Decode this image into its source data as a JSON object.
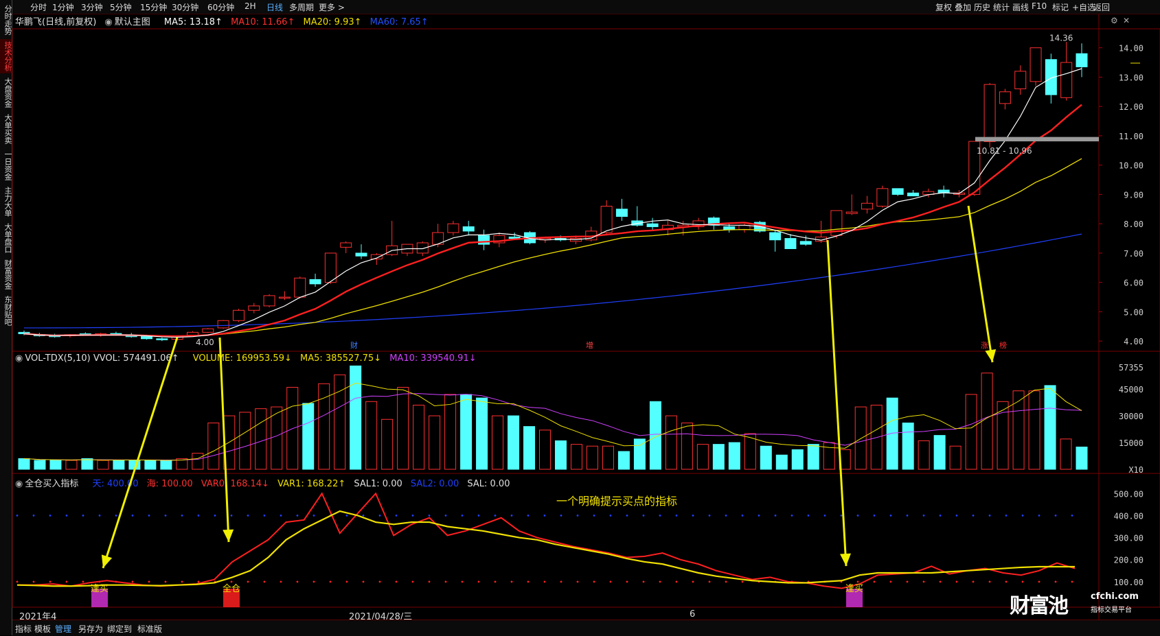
{
  "topbar": {
    "items": [
      "分时",
      "1分钟",
      "3分钟",
      "5分钟",
      "15分钟",
      "30分钟",
      "60分钟",
      "2H",
      "日线",
      "多周期",
      "更多 >"
    ],
    "right": [
      "复权",
      "叠加",
      "历史",
      "统计",
      "画线",
      "F10",
      "标记",
      "+自选",
      "返回"
    ]
  },
  "sidebar": {
    "items": [
      "分时走势",
      "技术分析",
      "大盘资金",
      "大单买卖",
      "一日资金",
      "主力大单",
      "大单盘口",
      "财富资金",
      "东财贴吧"
    ]
  },
  "price_panel": {
    "title": "华鹏飞(日线,前复权)",
    "template": "默认主图",
    "ma5": "MA5: 13.18↑",
    "ma10": "MA10: 11.66↑",
    "ma20": "MA20: 9.93↑",
    "ma60": "MA60: 7.65↑",
    "high_label": "14.36",
    "low_label": "4.00",
    "range_label": "10.81 - 10.96",
    "marker_cai": "财",
    "marker_zeng": "增",
    "marker_zhang": "涨",
    "marker_bang": "榜",
    "colors": {
      "ma5": "#ffffff",
      "ma10": "#ff2020",
      "ma20": "#f0e000",
      "ma60": "#2040ff",
      "up": "#ff3030",
      "down": "#54ffff"
    }
  },
  "volume_panel": {
    "title": "VOL-TDX(5,10) VVOL: 574491.06↑",
    "volume": "VOLUME: 169953.59↓",
    "ma5": "MA5: 385527.75↓",
    "ma10": "MA10: 339540.91↓",
    "unit": "X10",
    "axis_top": "57355"
  },
  "indicator_panel": {
    "title": "全仓买入指标",
    "tian": "天: 400.00",
    "hai": "海: 100.00",
    "var0": "VAR0: 168.14↓",
    "var1": "VAR1: 168.22↑",
    "sal1": "SAL1: 0.00",
    "sal2": "SAL2: 0.00",
    "sal": "SAL: 0.00",
    "annotation": "一个明确提示买点的指标",
    "signal_labels": [
      "逢买",
      "全仓",
      "逢买"
    ]
  },
  "date_axis": {
    "start": "2021年4",
    "mid": "2021/04/28/三",
    "mark": "6"
  },
  "footer": {
    "items": [
      "指标",
      "模板",
      "管理",
      "另存为",
      "绑定到",
      "标准版"
    ]
  },
  "watermark": {
    "logo": "财富池",
    "url": "cfchi.com",
    "sub": "指标交易平台"
  },
  "chart_data": [
    {
      "type": "candlestick",
      "title": "华鹏飞(日线,前复权)",
      "ylim": [
        3.7,
        14.6
      ],
      "yticks": [
        4.0,
        5.0,
        6.0,
        7.0,
        8.0,
        9.0,
        10.0,
        11.0,
        12.0,
        13.0,
        14.0
      ],
      "ohlc": [
        [
          4.3,
          4.36,
          4.2,
          4.25
        ],
        [
          4.22,
          4.28,
          4.15,
          4.18
        ],
        [
          4.2,
          4.25,
          4.12,
          4.15
        ],
        [
          4.18,
          4.24,
          4.12,
          4.22
        ],
        [
          4.25,
          4.3,
          4.18,
          4.22
        ],
        [
          4.2,
          4.28,
          4.15,
          4.25
        ],
        [
          4.26,
          4.32,
          4.18,
          4.2
        ],
        [
          4.2,
          4.28,
          4.12,
          4.15
        ],
        [
          4.16,
          4.22,
          4.05,
          4.08
        ],
        [
          4.08,
          4.12,
          4.0,
          4.05
        ],
        [
          4.06,
          4.2,
          4.02,
          4.18
        ],
        [
          4.2,
          4.34,
          4.15,
          4.3
        ],
        [
          4.3,
          4.45,
          4.28,
          4.42
        ],
        [
          4.45,
          4.72,
          4.42,
          4.7
        ],
        [
          4.7,
          5.1,
          4.65,
          5.05
        ],
        [
          5.05,
          5.3,
          4.95,
          5.2
        ],
        [
          5.2,
          5.6,
          5.15,
          5.55
        ],
        [
          5.5,
          5.7,
          5.4,
          5.5
        ],
        [
          5.5,
          6.2,
          5.45,
          6.15
        ],
        [
          6.1,
          6.3,
          5.85,
          5.95
        ],
        [
          6.0,
          7.0,
          5.95,
          7.0
        ],
        [
          7.2,
          7.4,
          7.0,
          7.35
        ],
        [
          7.0,
          7.3,
          6.8,
          6.9
        ],
        [
          6.8,
          7.0,
          6.6,
          6.95
        ],
        [
          6.95,
          8.1,
          6.9,
          7.25
        ],
        [
          7.0,
          7.3,
          6.9,
          7.3
        ],
        [
          7.0,
          7.4,
          6.9,
          7.35
        ],
        [
          7.3,
          8.0,
          7.2,
          7.7
        ],
        [
          7.7,
          8.1,
          7.6,
          8.0
        ],
        [
          7.9,
          8.1,
          7.6,
          7.75
        ],
        [
          7.6,
          7.8,
          7.1,
          7.3
        ],
        [
          7.35,
          7.7,
          7.2,
          7.6
        ],
        [
          7.55,
          7.7,
          7.45,
          7.5
        ],
        [
          7.7,
          7.75,
          7.3,
          7.35
        ],
        [
          7.45,
          7.55,
          7.35,
          7.5
        ],
        [
          7.5,
          7.6,
          7.4,
          7.45
        ],
        [
          7.4,
          7.6,
          7.3,
          7.5
        ],
        [
          7.45,
          7.9,
          7.4,
          7.75
        ],
        [
          7.7,
          8.8,
          7.6,
          8.6
        ],
        [
          8.5,
          8.85,
          8.1,
          8.25
        ],
        [
          8.1,
          8.6,
          7.9,
          7.95
        ],
        [
          8.0,
          8.2,
          7.8,
          7.9
        ],
        [
          7.8,
          8.1,
          7.6,
          7.95
        ],
        [
          7.9,
          8.1,
          7.6,
          7.95
        ],
        [
          7.9,
          8.2,
          7.8,
          8.1
        ],
        [
          8.2,
          8.25,
          7.8,
          7.95
        ],
        [
          7.9,
          8.0,
          7.7,
          7.8
        ],
        [
          7.8,
          8.0,
          7.7,
          7.95
        ],
        [
          8.05,
          8.1,
          7.7,
          7.75
        ],
        [
          7.7,
          7.8,
          7.05,
          7.45
        ],
        [
          7.5,
          7.65,
          7.2,
          7.15
        ],
        [
          7.4,
          7.6,
          7.25,
          7.3
        ],
        [
          7.4,
          8.1,
          7.35,
          7.55
        ],
        [
          7.6,
          8.45,
          7.5,
          8.45
        ],
        [
          8.35,
          9.0,
          8.3,
          8.4
        ],
        [
          8.5,
          8.95,
          8.35,
          8.7
        ],
        [
          8.6,
          9.3,
          8.55,
          9.2
        ],
        [
          9.2,
          9.2,
          8.95,
          9.0
        ],
        [
          9.05,
          9.15,
          8.95,
          8.95
        ],
        [
          9.0,
          9.2,
          8.9,
          9.1
        ],
        [
          9.15,
          9.3,
          8.9,
          9.05
        ],
        [
          9.0,
          9.15,
          8.9,
          9.05
        ],
        [
          9.0,
          10.81,
          8.95,
          10.81
        ],
        [
          10.8,
          12.8,
          10.6,
          12.75
        ],
        [
          12.1,
          12.6,
          11.9,
          12.5
        ],
        [
          12.6,
          13.4,
          12.4,
          13.2
        ],
        [
          12.85,
          14.0,
          12.7,
          14.0
        ],
        [
          13.6,
          13.8,
          12.1,
          12.4
        ],
        [
          12.3,
          14.2,
          12.2,
          13.5
        ],
        [
          13.8,
          14.15,
          13.0,
          13.35
        ]
      ],
      "ma5_last": 13.18,
      "ma10_last": 11.66,
      "ma20_last": 9.93,
      "ma60_last": 7.65
    },
    {
      "type": "bar",
      "title": "VOL-TDX(5,10)",
      "ylim": [
        0,
        57355
      ],
      "yticks": [
        15000,
        30000,
        45000
      ],
      "values": [
        6000,
        5000,
        5000,
        5000,
        6000,
        5000,
        5000,
        5000,
        5000,
        5000,
        6000,
        9000,
        26000,
        30000,
        32000,
        34000,
        35000,
        46000,
        37000,
        48000,
        53000,
        58000,
        38000,
        28000,
        46000,
        36000,
        30000,
        42000,
        42000,
        40000,
        30000,
        30000,
        24000,
        22000,
        16000,
        14000,
        13000,
        13000,
        10000,
        17000,
        38000,
        30000,
        26000,
        14000,
        14000,
        15000,
        20000,
        13000,
        8000,
        11000,
        14000,
        15000,
        11000,
        35000,
        36000,
        40000,
        26000,
        16000,
        19000,
        13000,
        42000,
        54000,
        38000,
        44000,
        44000,
        47000,
        17000,
        12500
      ]
    },
    {
      "type": "line",
      "title": "全仓买入指标",
      "ylim": [
        0,
        560
      ],
      "yticks": [
        100,
        200,
        300,
        400,
        500
      ],
      "series": [
        {
          "name": "VAR0",
          "values": [
            85,
            85,
            90,
            80,
            95,
            105,
            95,
            85,
            80,
            85,
            90,
            110,
            190,
            240,
            290,
            370,
            380,
            500,
            320,
            410,
            500,
            310,
            360,
            390,
            310,
            330,
            360,
            390,
            330,
            300,
            280,
            260,
            245,
            230,
            210,
            215,
            230,
            200,
            180,
            150,
            130,
            110,
            120,
            100,
            95,
            80,
            70,
            90,
            130,
            135,
            140,
            170,
            135,
            150,
            160,
            140,
            130,
            150,
            185,
            160
          ]
        },
        {
          "name": "VAR1",
          "values": [
            85,
            83,
            80,
            80,
            82,
            85,
            85,
            83,
            82,
            85,
            88,
            95,
            120,
            150,
            210,
            290,
            340,
            380,
            420,
            400,
            370,
            360,
            370,
            370,
            350,
            340,
            330,
            315,
            300,
            290,
            270,
            255,
            240,
            225,
            205,
            190,
            180,
            160,
            140,
            125,
            115,
            105,
            100,
            95,
            95,
            100,
            105,
            130,
            140,
            140,
            140,
            140,
            145,
            150,
            155,
            160,
            165,
            168,
            168,
            168
          ]
        }
      ]
    }
  ]
}
